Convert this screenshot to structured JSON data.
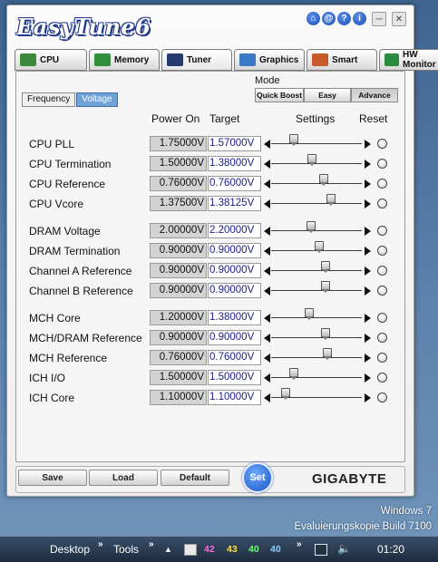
{
  "app": {
    "title": "EasyTune6",
    "title_buttons": [
      {
        "name": "home-icon",
        "glyph": "⌂"
      },
      {
        "name": "email-icon",
        "glyph": "@"
      },
      {
        "name": "help-icon",
        "glyph": "?"
      },
      {
        "name": "info-icon",
        "glyph": "i"
      },
      {
        "name": "minimize-icon",
        "glyph": "─"
      },
      {
        "name": "close-icon",
        "glyph": "✕"
      }
    ]
  },
  "tabs": [
    {
      "label": "CPU",
      "icon": "cpu-icon",
      "color": "#3d8a3d"
    },
    {
      "label": "Memory",
      "icon": "memory-icon",
      "color": "#2f8f3a"
    },
    {
      "label": "Tuner",
      "icon": "tuner-icon",
      "color": "#243b6e",
      "active": true
    },
    {
      "label": "Graphics",
      "icon": "graphics-icon",
      "color": "#3a79c8"
    },
    {
      "label": "Smart",
      "icon": "smart-icon",
      "color": "#c85a2a"
    },
    {
      "label": "HW Monitor",
      "icon": "hw-monitor-icon",
      "color": "#2a8a3f"
    }
  ],
  "subtabs": [
    {
      "label": "Frequency",
      "active": false
    },
    {
      "label": "Voltage",
      "active": true
    }
  ],
  "mode": {
    "label": "Mode",
    "options": [
      {
        "label": "Quick Boost",
        "active": false
      },
      {
        "label": "Easy",
        "active": false
      },
      {
        "label": "Advance",
        "active": true
      }
    ]
  },
  "columns": {
    "power_on": "Power On",
    "target": "Target",
    "settings": "Settings",
    "reset": "Reset"
  },
  "rows": [
    {
      "label": "CPU PLL",
      "power_on": "1.75000V",
      "target": "1.57000V",
      "slider": 0.22
    },
    {
      "label": "CPU Termination",
      "power_on": "1.50000V",
      "target": "1.38000V",
      "slider": 0.44
    },
    {
      "label": "CPU Reference",
      "power_on": "0.76000V",
      "target": "0.76000V",
      "slider": 0.58
    },
    {
      "label": "CPU Vcore",
      "power_on": "1.37500V",
      "target": "1.38125V",
      "slider": 0.66
    },
    {
      "label": "DRAM Voltage",
      "power_on": "2.00000V",
      "target": "2.20000V",
      "slider": 0.42
    },
    {
      "label": "DRAM Termination",
      "power_on": "0.90000V",
      "target": "0.90000V",
      "slider": 0.52
    },
    {
      "label": "Channel A Reference",
      "power_on": "0.90000V",
      "target": "0.90000V",
      "slider": 0.6
    },
    {
      "label": "Channel B Reference",
      "power_on": "0.90000V",
      "target": "0.90000V",
      "slider": 0.6
    },
    {
      "label": "MCH Core",
      "power_on": "1.20000V",
      "target": "1.38000V",
      "slider": 0.4
    },
    {
      "label": "MCH/DRAM Reference",
      "power_on": "0.90000V",
      "target": "0.90000V",
      "slider": 0.6
    },
    {
      "label": "MCH Reference",
      "power_on": "0.76000V",
      "target": "0.76000V",
      "slider": 0.62
    },
    {
      "label": "ICH I/O",
      "power_on": "1.50000V",
      "target": "1.50000V",
      "slider": 0.22
    },
    {
      "label": "ICH Core",
      "power_on": "1.10000V",
      "target": "1.10000V",
      "slider": 0.12
    }
  ],
  "footer": {
    "save": "Save",
    "load": "Load",
    "default": "Default",
    "set": "Set",
    "brand": "GIGABYTE"
  },
  "desktop": {
    "line1": "Windows 7",
    "line2": "Evaluierungskopie Build 7100"
  },
  "taskbar": {
    "desktop": "Desktop",
    "tools": "Tools",
    "tray_numbers": [
      {
        "value": "42",
        "color": "#ff6ad5"
      },
      {
        "value": "43",
        "color": "#ffe04a"
      },
      {
        "value": "40",
        "color": "#6dff6d"
      },
      {
        "value": "40",
        "color": "#8ad1ff"
      }
    ],
    "clock": "01:20"
  }
}
